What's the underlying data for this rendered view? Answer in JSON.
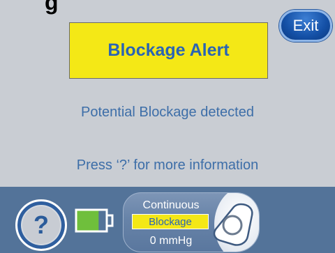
{
  "header": {
    "title": "g",
    "exit_label": "Exit"
  },
  "alert": {
    "title": "Blockage Alert",
    "message": "Potential Blockage detected",
    "instruction": "Press ‘?’ for more information"
  },
  "status_bar": {
    "help_label": "?",
    "battery_icon": "battery-icon",
    "battery_level": 0.75,
    "mode": "Continuous",
    "status": "Blockage",
    "pressure": "0 mmHg",
    "pump_icon": "pump-icon"
  },
  "colors": {
    "background": "#c9cdd3",
    "alert_yellow": "#f4e816",
    "text_blue": "#3d6ea8",
    "bar_blue": "#537399",
    "battery_green": "#6fbf3c"
  }
}
